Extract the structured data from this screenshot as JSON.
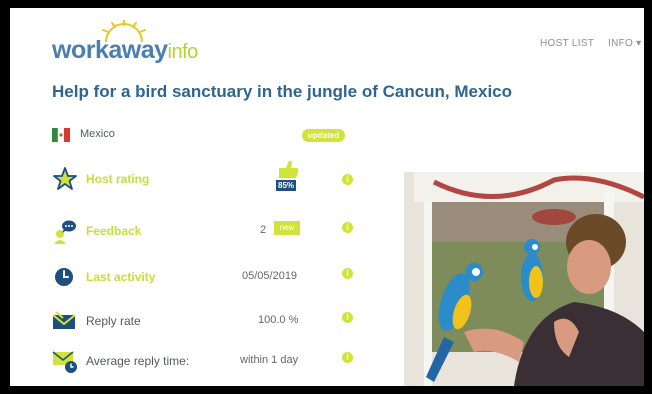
{
  "header": {
    "logo_main": "workaway",
    "logo_suffix": "info",
    "nav": {
      "host_list": "HOST LIST",
      "info": "INFO ▾"
    }
  },
  "listing": {
    "title": "Help for a bird sanctuary in the jungle of Cancun, Mexico",
    "country": "Mexico",
    "updated_badge": "updated",
    "host_rating": {
      "label": "Host rating",
      "percent": "85%"
    },
    "feedback": {
      "label": "Feedback",
      "count": "2",
      "badge": "new"
    },
    "last_activity": {
      "label": "Last activity",
      "value": "05/05/2019"
    },
    "reply_rate": {
      "label": "Reply rate",
      "value": "100.0 %"
    },
    "avg_reply_time": {
      "label": "Average reply time:",
      "value": "within 1 day"
    }
  },
  "colors": {
    "brand_blue": "#2e6593",
    "accent_lime": "#cfe33c",
    "icon_navy": "#1f4f7e"
  },
  "icons": [
    "mexico-flag-icon",
    "star-icon",
    "chat-icon",
    "clock-icon",
    "envelope-icon",
    "envelope-clock-icon",
    "info-icon",
    "thumbs-up-icon"
  ]
}
